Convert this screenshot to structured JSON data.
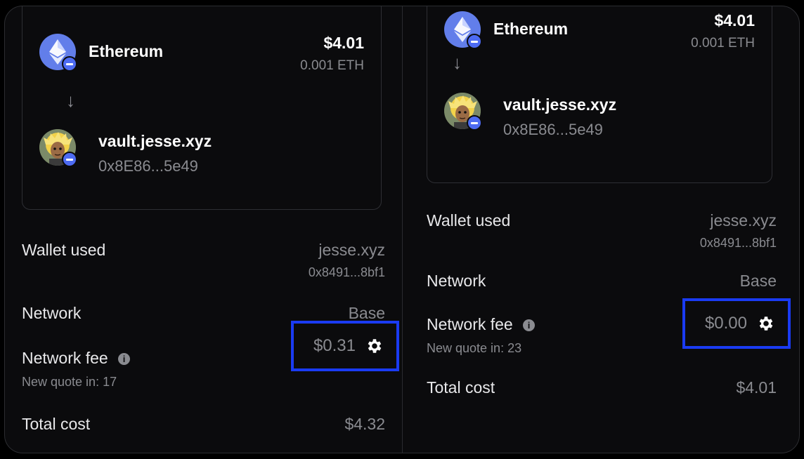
{
  "panels": [
    {
      "send": {
        "asset": "Ethereum",
        "usd": "$4.01",
        "amount": "0.001 ETH",
        "arrow": "↓",
        "recipient_name": "vault.jesse.xyz",
        "recipient_address": "0x8E86...5e49"
      },
      "wallet": {
        "label": "Wallet used",
        "name": "jesse.xyz",
        "address": "0x8491...8bf1"
      },
      "network": {
        "label": "Network",
        "value": "Base"
      },
      "fee": {
        "label": "Network fee",
        "info": "i",
        "quote": "New quote in: 17",
        "value": "$0.31"
      },
      "total": {
        "label": "Total cost",
        "value": "$4.32"
      }
    },
    {
      "send": {
        "asset": "Ethereum",
        "usd": "$4.01",
        "amount": "0.001 ETH",
        "arrow": "↓",
        "recipient_name": "vault.jesse.xyz",
        "recipient_address": "0x8E86...5e49"
      },
      "wallet": {
        "label": "Wallet used",
        "name": "jesse.xyz",
        "address": "0x8491...8bf1"
      },
      "network": {
        "label": "Network",
        "value": "Base"
      },
      "fee": {
        "label": "Network fee",
        "info": "i",
        "quote": "New quote in: 23",
        "value": "$0.00"
      },
      "total": {
        "label": "Total cost",
        "value": "$4.01"
      }
    }
  ],
  "icons": {
    "coin": "ethereum-icon",
    "badge": "minus-badge-icon",
    "avatar": "avatar",
    "settings": "gear-icon",
    "info": "info-icon"
  },
  "colors": {
    "background": "#0b0b0d",
    "ethereum": "#627eea",
    "badge": "#4d6bf2",
    "highlight": "#1a3bf2",
    "muted": "#8a8b90"
  }
}
